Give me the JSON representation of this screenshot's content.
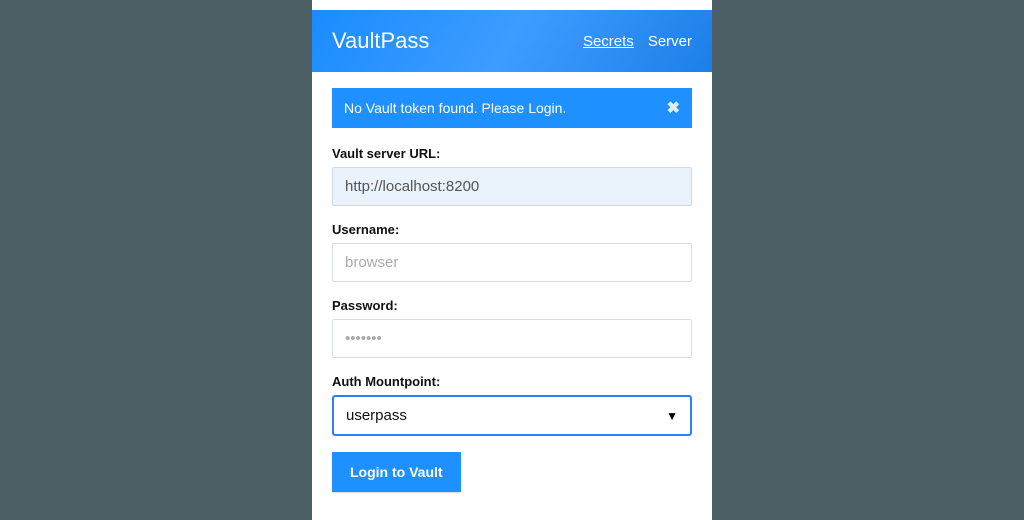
{
  "brand": "VaultPass",
  "nav": {
    "secrets": "Secrets",
    "server": "Server"
  },
  "alert": {
    "text": "No Vault token found. Please Login.",
    "close_glyph": "✖"
  },
  "form": {
    "url_label": "Vault server URL:",
    "url_value": "http://localhost:8200",
    "username_label": "Username:",
    "username_placeholder": "browser",
    "password_label": "Password:",
    "password_placeholder": "•••••••",
    "mount_label": "Auth Mountpoint:",
    "mount_value": "userpass",
    "submit_label": "Login to Vault"
  }
}
